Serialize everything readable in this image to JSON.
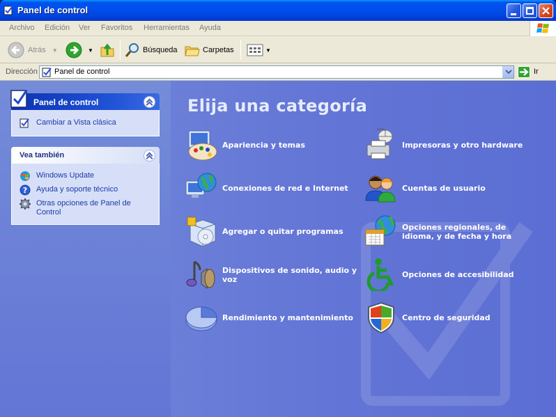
{
  "window": {
    "title": "Panel de control"
  },
  "menubar": {
    "items": [
      "Archivo",
      "Edición",
      "Ver",
      "Favoritos",
      "Herramientas",
      "Ayuda"
    ]
  },
  "toolbar": {
    "back_label": "Atrás",
    "search_label": "Búsqueda",
    "folders_label": "Carpetas"
  },
  "addressbar": {
    "label": "Dirección",
    "value": "Panel de control",
    "go_label": "Ir"
  },
  "sidebar": {
    "panel_box": {
      "title": "Panel de control",
      "links": [
        {
          "label": "Cambiar a Vista clásica",
          "icon": "control-panel-icon"
        }
      ]
    },
    "see_also_box": {
      "title": "Vea también",
      "links": [
        {
          "label": "Windows Update",
          "icon": "windows-update-icon"
        },
        {
          "label": "Ayuda y soporte técnico",
          "icon": "help-icon"
        },
        {
          "label": "Otras opciones de Panel de Control",
          "icon": "gear-icon"
        }
      ]
    }
  },
  "main": {
    "heading": "Elija una categoría",
    "categories": [
      {
        "label": "Apariencia y temas",
        "icon": "appearance-palette-icon"
      },
      {
        "label": "Impresoras y otro hardware",
        "icon": "printer-mouse-icon"
      },
      {
        "label": "Conexiones de red e Internet",
        "icon": "network-globe-icon"
      },
      {
        "label": "Cuentas de usuario",
        "icon": "user-accounts-icon"
      },
      {
        "label": "Agregar o quitar programas",
        "icon": "add-remove-programs-icon"
      },
      {
        "label": "Opciones regionales, de idioma, y de fecha y hora",
        "icon": "regional-calendar-globe-icon"
      },
      {
        "label": "Dispositivos de sonido, audio y voz",
        "icon": "sound-speaker-icon"
      },
      {
        "label": "Opciones de accesibilidad",
        "icon": "accessibility-icon"
      },
      {
        "label": "Rendimiento y mantenimiento",
        "icon": "performance-pie-icon"
      },
      {
        "label": "Centro de seguridad",
        "icon": "security-shield-icon"
      }
    ]
  },
  "colors": {
    "titlebar": "#0054e3",
    "main_background": "#6375d6",
    "task_link": "#1c3aab"
  }
}
